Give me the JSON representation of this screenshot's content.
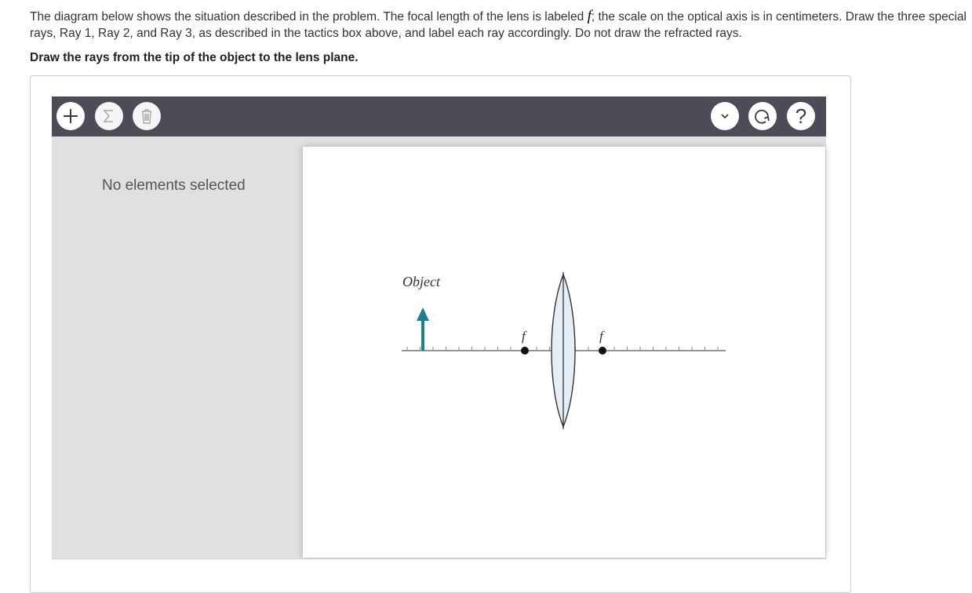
{
  "problem": {
    "text_before": "The diagram below shows the situation described in the problem. The focal length of the lens is labeled ",
    "f_symbol": "f",
    "text_after": "; the scale on the optical axis is in centimeters. Draw the three special rays, Ray 1, Ray 2, and Ray 3, as described in the tactics box above, and label each ray accordingly. Do not draw the refracted rays."
  },
  "instruction": "Draw the rays from the tip of the object to the lens plane.",
  "toolbar": {
    "left_buttons": [
      "add",
      "sigma",
      "trash"
    ],
    "right_buttons": [
      "expand",
      "reset",
      "help"
    ],
    "help_label": "?"
  },
  "side_panel": {
    "status": "No elements selected"
  },
  "diagram": {
    "object_label": "Object",
    "focal_label_left": "f",
    "focal_label_right": "f"
  },
  "colors": {
    "toolbar_bg": "#4c4c56",
    "panel_bg": "#e0e0e0",
    "object_arrow": "#1e7e96",
    "lens_fill": "#e6eef5"
  }
}
